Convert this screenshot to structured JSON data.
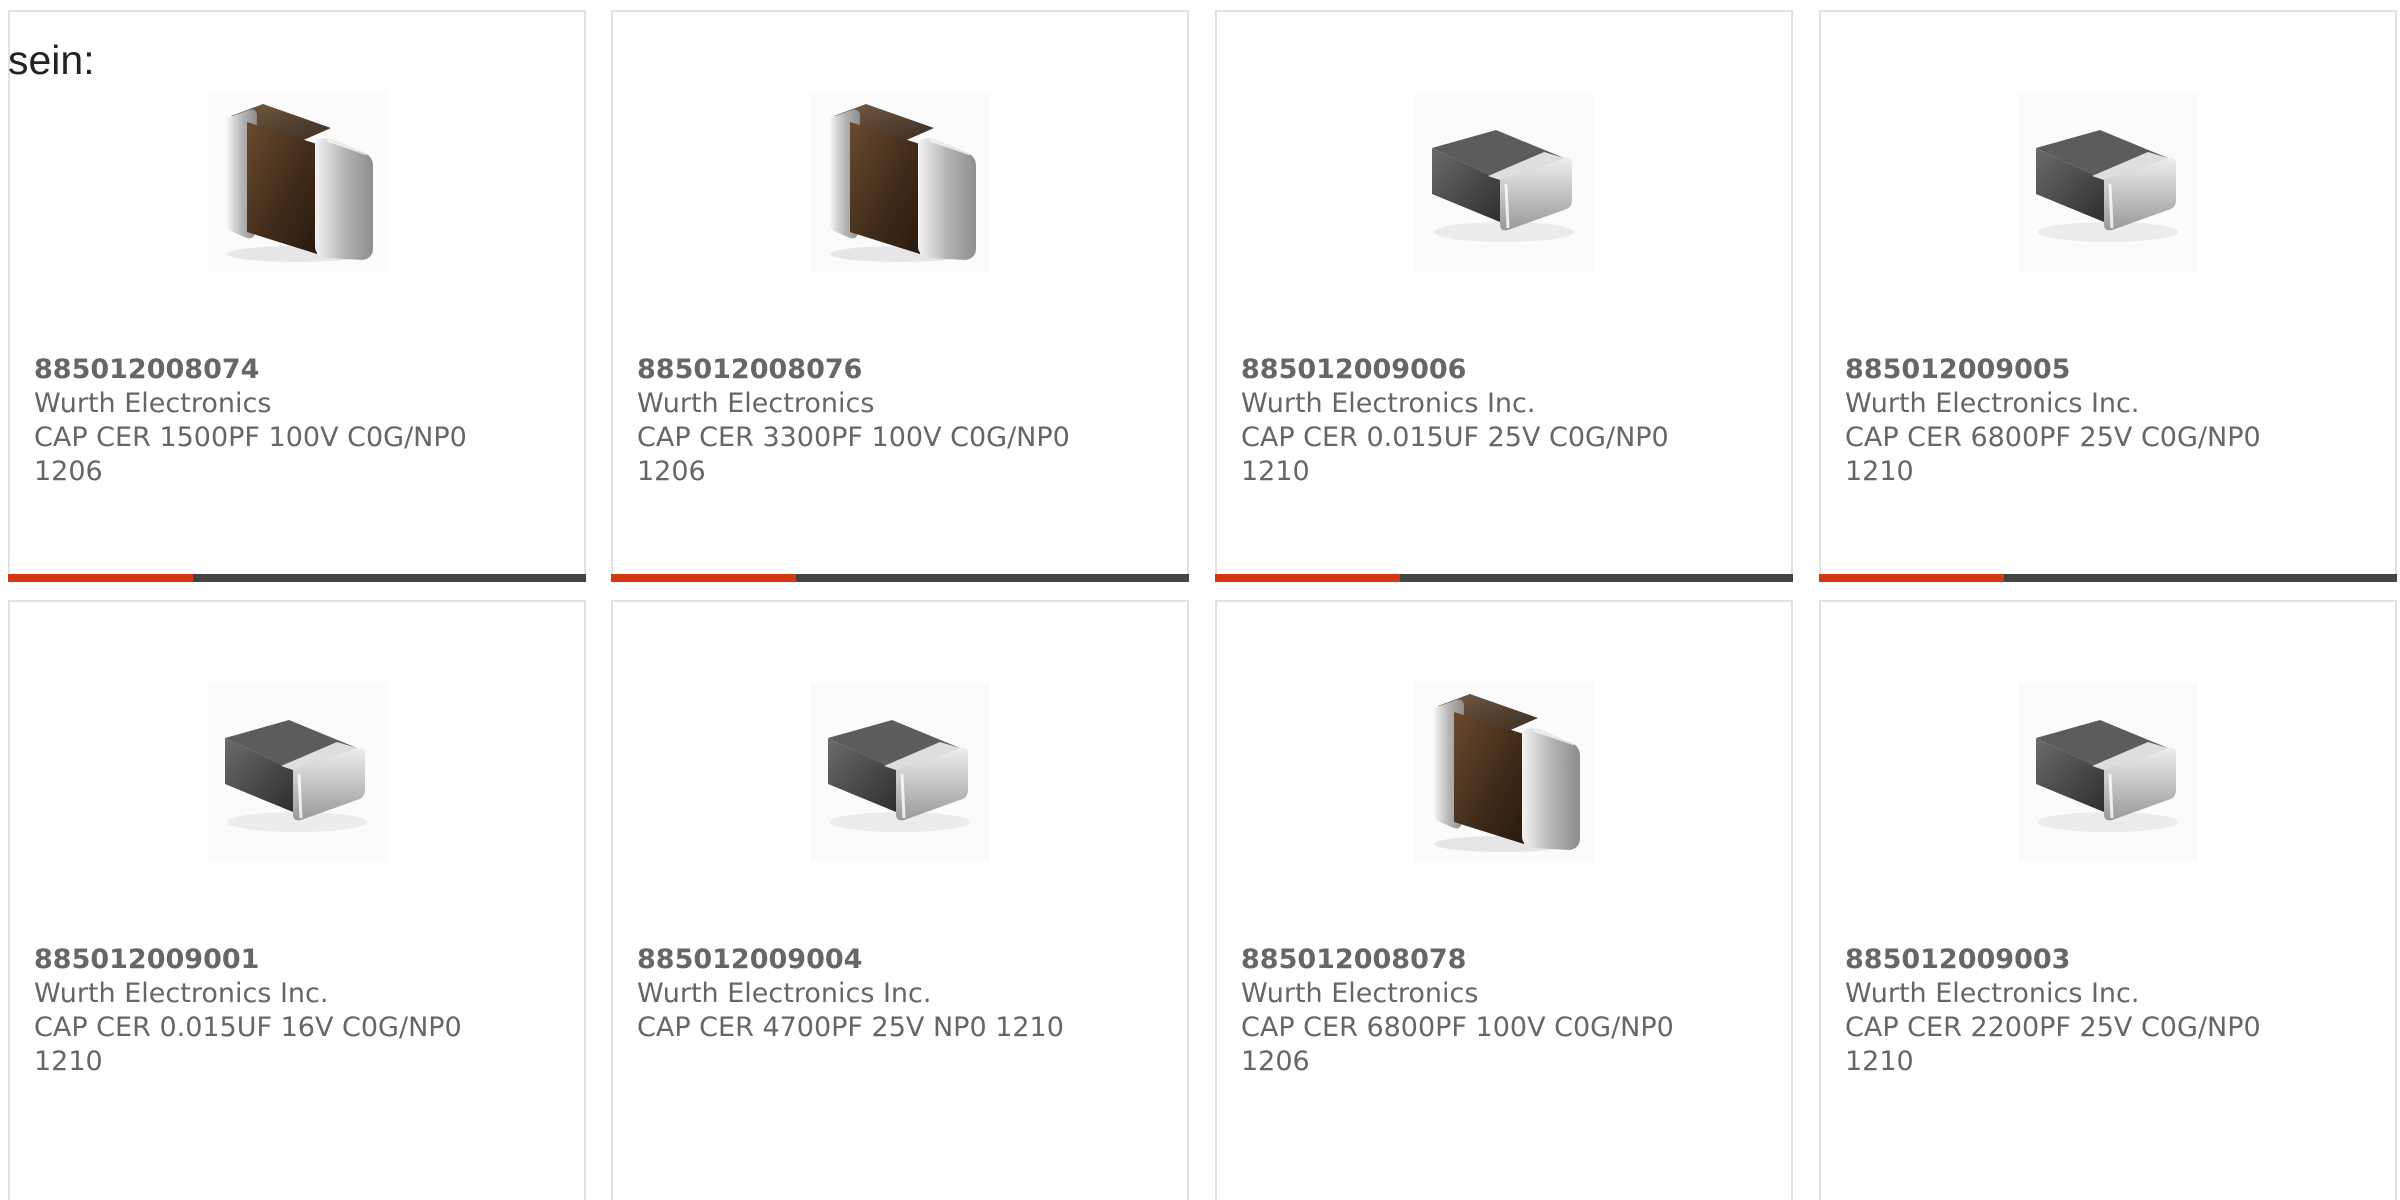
{
  "intro_text": "sein:",
  "colors": {
    "accent": "#d5380e",
    "bar_track": "#444444",
    "text": "#666666",
    "border": "#e2e2e2"
  },
  "products": [
    {
      "pn": "885012008074",
      "mfr": "Wurth Electronics",
      "desc1": "CAP CER 1500PF 100V C0G/NP0",
      "desc2": "1206",
      "icon": "mlcc-brown-capacitor-icon",
      "progress": 0.32
    },
    {
      "pn": "885012008076",
      "mfr": "Wurth Electronics",
      "desc1": "CAP CER 3300PF 100V C0G/NP0",
      "desc2": "1206",
      "icon": "mlcc-brown-capacitor-icon",
      "progress": 0.32
    },
    {
      "pn": "885012009006",
      "mfr": "Wurth Electronics Inc.",
      "desc1": "CAP CER 0.015UF 25V C0G/NP0",
      "desc2": "1210",
      "icon": "mlcc-dark-capacitor-icon",
      "progress": 0.32
    },
    {
      "pn": "885012009005",
      "mfr": "Wurth Electronics Inc.",
      "desc1": "CAP CER 6800PF 25V C0G/NP0",
      "desc2": "1210",
      "icon": "mlcc-dark-capacitor-icon",
      "progress": 0.32
    },
    {
      "pn": "885012009001",
      "mfr": "Wurth Electronics Inc.",
      "desc1": "CAP CER 0.015UF 16V C0G/NP0",
      "desc2": "1210",
      "icon": "mlcc-dark-capacitor-icon"
    },
    {
      "pn": "885012009004",
      "mfr": "Wurth Electronics Inc.",
      "desc1": "CAP CER 4700PF 25V NP0 1210",
      "desc2": "",
      "icon": "mlcc-dark-capacitor-icon"
    },
    {
      "pn": "885012008078",
      "mfr": "Wurth Electronics",
      "desc1": "CAP CER 6800PF 100V C0G/NP0",
      "desc2": "1206",
      "icon": "mlcc-brown-capacitor-icon"
    },
    {
      "pn": "885012009003",
      "mfr": "Wurth Electronics Inc.",
      "desc1": "CAP CER 2200PF 25V C0G/NP0",
      "desc2": "1210",
      "icon": "mlcc-dark-capacitor-icon"
    }
  ]
}
